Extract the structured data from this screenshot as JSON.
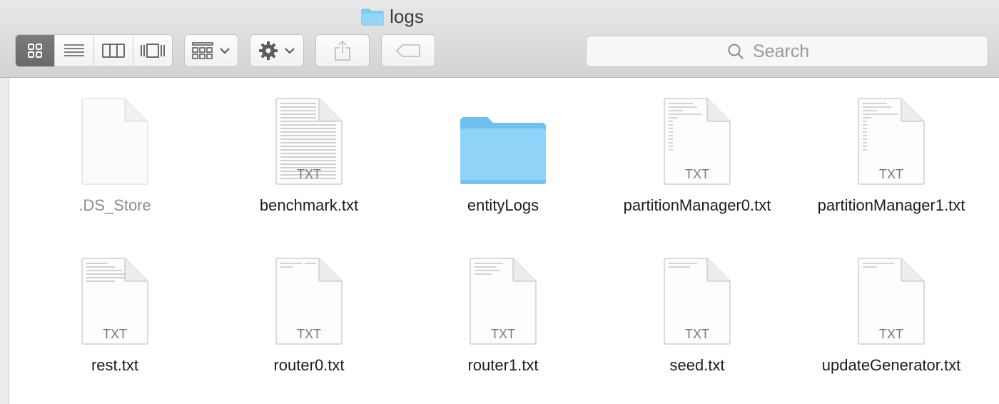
{
  "window": {
    "title": "logs"
  },
  "toolbar": {
    "view_modes": [
      "icon-view",
      "list-view",
      "column-view",
      "cover-flow-view"
    ],
    "active_view": "icon-view",
    "arrange_icon": "arrange-grid-icon",
    "action_icon": "gear-icon",
    "share_icon": "share-icon",
    "tag_icon": "tag-icon"
  },
  "search": {
    "placeholder": "Search"
  },
  "files": [
    {
      "name": ".DS_Store",
      "type": "blank",
      "badge": ""
    },
    {
      "name": "benchmark.txt",
      "type": "txt",
      "badge": "TXT"
    },
    {
      "name": "entityLogs",
      "type": "folder",
      "badge": ""
    },
    {
      "name": "partitionManager0.txt",
      "type": "txt",
      "badge": "TXT"
    },
    {
      "name": "partitionManager1.txt",
      "type": "txt",
      "badge": "TXT"
    },
    {
      "name": "rest.txt",
      "type": "txt",
      "badge": "TXT"
    },
    {
      "name": "router0.txt",
      "type": "txt",
      "badge": "TXT"
    },
    {
      "name": "router1.txt",
      "type": "txt",
      "badge": "TXT"
    },
    {
      "name": "seed.txt",
      "type": "txt",
      "badge": "TXT"
    },
    {
      "name": "updateGenerator.txt",
      "type": "txt",
      "badge": "TXT"
    }
  ],
  "colors": {
    "folder_blue": "#7fccf5",
    "active_segment": "#6f6f6f"
  }
}
